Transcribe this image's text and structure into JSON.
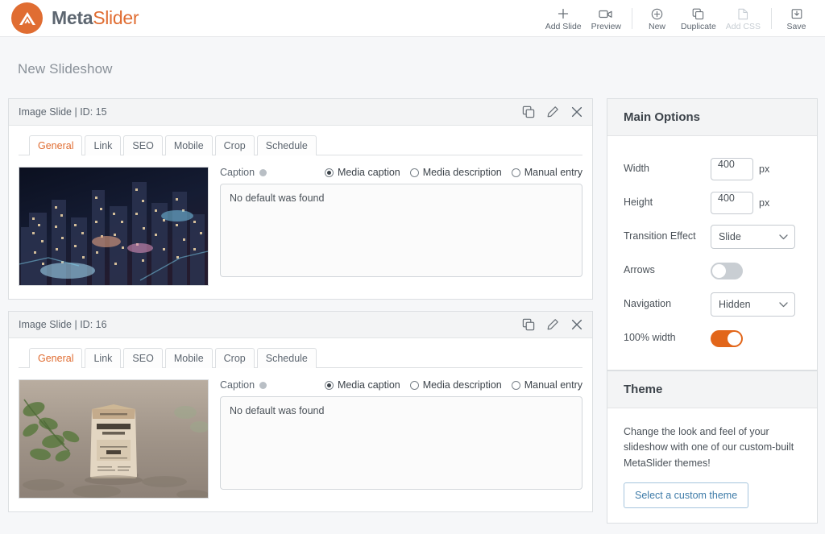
{
  "brand": {
    "name_bold": "Meta",
    "name_light": "Slider",
    "logo_icon": "metaslider-mountain-logo",
    "logo_color": "#e06d32"
  },
  "toolbar": {
    "items": [
      {
        "label": "Add Slide",
        "icon": "plus-icon",
        "disabled": false
      },
      {
        "label": "Preview",
        "icon": "video-camera-icon",
        "disabled": false
      },
      {
        "label": "New",
        "icon": "plus-circle-icon",
        "disabled": false
      },
      {
        "label": "Duplicate",
        "icon": "copy-icon",
        "disabled": false
      },
      {
        "label": "Add CSS",
        "icon": "css-page-icon",
        "disabled": true
      },
      {
        "label": "Save",
        "icon": "save-icon",
        "disabled": false
      }
    ]
  },
  "page": {
    "title": "New Slideshow"
  },
  "slides": [
    {
      "header": "Image Slide | ID: 15",
      "tabs": [
        "General",
        "Link",
        "SEO",
        "Mobile",
        "Crop",
        "Schedule"
      ],
      "active_tab": "General",
      "thumbnail_alt": "aerial night cityscape with lit skyscrapers",
      "caption_label": "Caption",
      "caption_options": [
        "Media caption",
        "Media description",
        "Manual entry"
      ],
      "caption_selected": "Media caption",
      "caption_value": "No default was found",
      "actions": [
        "duplicate-slide-icon",
        "edit-slide-icon",
        "delete-slide-icon"
      ]
    },
    {
      "header": "Image Slide | ID: 16",
      "tabs": [
        "General",
        "Link",
        "SEO",
        "Mobile",
        "Crop",
        "Schedule"
      ],
      "active_tab": "General",
      "thumbnail_alt": "paper bag of coffee beans on dirt ground with green plants",
      "caption_label": "Caption",
      "caption_options": [
        "Media caption",
        "Media description",
        "Manual entry"
      ],
      "caption_selected": "Media caption",
      "caption_value": "No default was found",
      "actions": [
        "duplicate-slide-icon",
        "edit-slide-icon",
        "delete-slide-icon"
      ]
    }
  ],
  "main_options": {
    "title": "Main Options",
    "width": {
      "label": "Width",
      "value": "400",
      "unit": "px"
    },
    "height": {
      "label": "Height",
      "value": "400",
      "unit": "px"
    },
    "transition": {
      "label": "Transition Effect",
      "value": "Slide"
    },
    "arrows": {
      "label": "Arrows",
      "on": false
    },
    "navigation": {
      "label": "Navigation",
      "value": "Hidden"
    },
    "full_width": {
      "label": "100% width",
      "on": true
    }
  },
  "theme": {
    "title": "Theme",
    "description": "Change the look and feel of your slideshow with one of our custom-built MetaSlider themes!",
    "button_label": "Select a custom theme"
  },
  "colors": {
    "accent": "#e06d32",
    "toggle_on": "#e2661a",
    "link": "#3e7ba8"
  }
}
